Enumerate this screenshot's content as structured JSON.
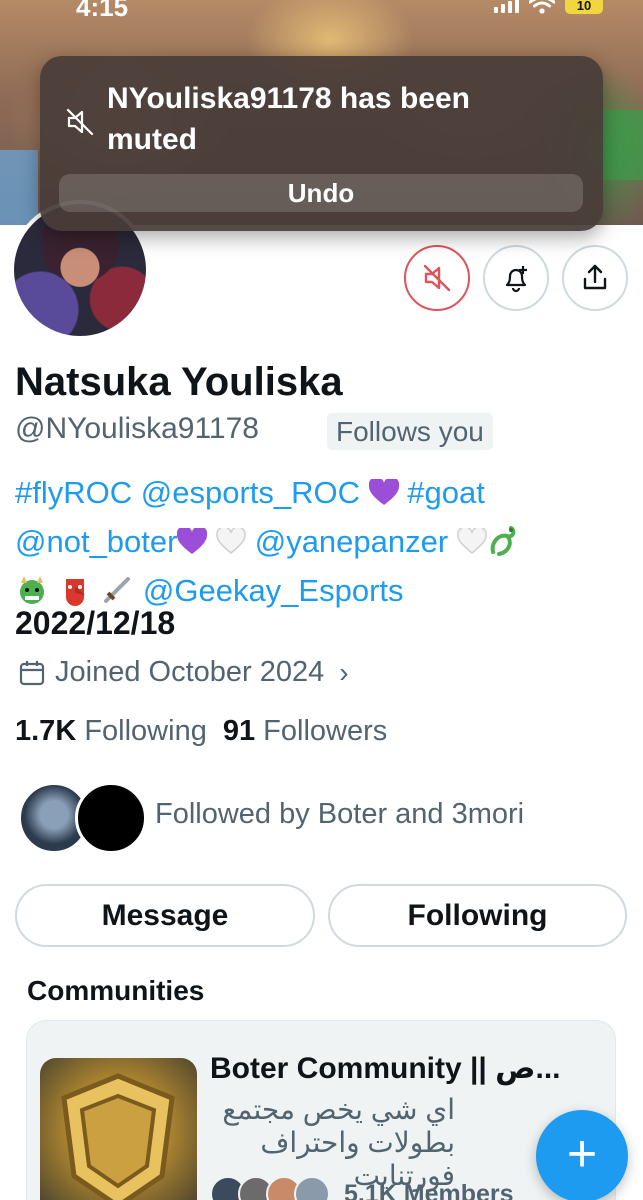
{
  "status_bar": {
    "time": "4:15",
    "battery": "10",
    "icons": [
      "signal-icon",
      "wifi-icon",
      "battery-icon"
    ]
  },
  "toast": {
    "icon": "mute-icon",
    "message": "NYouliska91178 has been muted",
    "undo_label": "Undo"
  },
  "profile": {
    "display_name": "Natsuka Youliska",
    "handle": "@NYouliska91178",
    "follows_you_badge": "Follows you",
    "bio": {
      "tag_flyroc": "#flyROC",
      "mention_esports_roc": "@esports_ROC",
      "tag_goat": "#goat",
      "mention_not_boter": "@not_boter",
      "mention_yanepanzer": "@yanepanzer",
      "mention_geekay": "@Geekay_Esports",
      "date": "2022/12/18"
    },
    "joined": "Joined October 2024",
    "following_count": "1.7K",
    "following_label": "Following",
    "followers_count": "91",
    "followers_label": "Followers",
    "followed_by": "Followed by Boter and 3mori"
  },
  "actions": {
    "icons": [
      "unmute-icon",
      "notifications-icon",
      "share-icon"
    ]
  },
  "buttons": {
    "message": "Message",
    "following": "Following"
  },
  "communities": {
    "title": "Communities",
    "card": {
      "name": "Boter Community || ص...",
      "description": "اي شي يخص مجتمع بطولات واحتراف فورتنايت",
      "members": "5.1K Members"
    }
  },
  "fab": {
    "label": "+"
  },
  "colors": {
    "accent": "#1d9bf0",
    "muted_red": "#e0535b",
    "secondary_text": "#536471",
    "primary_text": "#0f1419",
    "toast_bg": "#483c38"
  }
}
